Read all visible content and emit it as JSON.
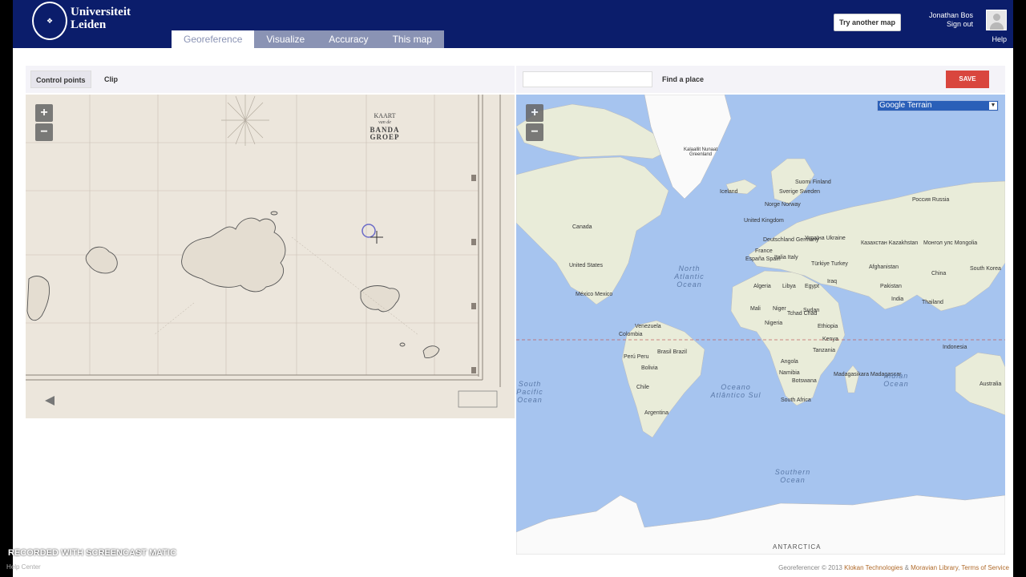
{
  "header": {
    "brand_line1": "Universiteit",
    "brand_line2": "Leiden",
    "tabs": [
      {
        "label": "Georeference",
        "active": true
      },
      {
        "label": "Visualize",
        "active": false
      },
      {
        "label": "Accuracy",
        "active": false
      },
      {
        "label": "This map",
        "active": false
      }
    ],
    "try_another_map": "Try another map",
    "user_name": "Jonathan Bos",
    "sign_out": "Sign out",
    "help": "Help"
  },
  "left_toolbar": {
    "control_points": "Control points",
    "clip": "Clip"
  },
  "old_map": {
    "title_line1": "KAART",
    "title_line2": "van de",
    "title_line3": "BANDA GROEP"
  },
  "zoom": {
    "in": "+",
    "out": "−"
  },
  "right_toolbar": {
    "search_value": "",
    "find_place": "Find a place",
    "save": "SAVE"
  },
  "map_type": {
    "selected": "Google Terrain"
  },
  "countries": {
    "kalaallit": "Kalaallit Nunaat Greenland",
    "iceland": "Iceland",
    "sverige": "Sverige Sweden",
    "suomi": "Suomi Finland",
    "norge": "Norge Norway",
    "uk": "United Kingdom",
    "deutschland": "Deutschland Germany",
    "ukraine": "Україна Ukraine",
    "kazakhstan": "Казахстан Kazakhstan",
    "russia": "Россия Russia",
    "mongolia": "Монгол улс Mongolia",
    "france": "France",
    "italia": "Italia Italy",
    "espana": "España Spain",
    "turkiye": "Türkiye Turkey",
    "iraq": "Iraq",
    "afghanistan": "Afghanistan",
    "china": "China",
    "south_korea": "South Korea",
    "canada": "Canada",
    "united_states": "United States",
    "mexico": "México Mexico",
    "algeria": "Algeria",
    "libya": "Libya",
    "egypt": "Egypt",
    "pakistan": "Pakistan",
    "india": "India",
    "thailand": "Thailand",
    "mali": "Mali",
    "niger": "Niger",
    "chad": "Tchad Chad",
    "sudan": "Sudan",
    "nigeria": "Nigeria",
    "ethiopia": "Ethiopia",
    "venezuela": "Venezuela",
    "colombia": "Colombia",
    "peru": "Perú Peru",
    "brasil": "Brasil Brazil",
    "bolivia": "Bolivia",
    "kenya": "Kenya",
    "tanzania": "Tanzania",
    "indonesia": "Indonesia",
    "angola": "Angola",
    "namibia": "Namibia",
    "botswana": "Botswana",
    "madagasikara": "Madagasikara Madagascar",
    "chile": "Chile",
    "argentina": "Argentina",
    "south_africa": "South Africa",
    "australia": "Australia"
  },
  "oceans": {
    "north_atlantic": "North Atlantic Ocean",
    "south_atlantic": "Oceano Atlântico Sul",
    "south_pacific": "South Pacific Ocean",
    "indian": "Indian Ocean",
    "southern": "Southern Ocean",
    "antarctica": "ANTARCTICA"
  },
  "footer": {
    "prefix": "Georeferencer © 2013 ",
    "klokan": "Klokan Technologies",
    "amp": " & ",
    "moravian": "Moravian Library",
    "sep": ", ",
    "terms": "Terms of Service"
  },
  "watermark": "RECORDED WITH SCREENCAST MATIC",
  "help_center": "Help Center",
  "colors": {
    "header": "#0b1d6b",
    "tab_inactive": "#8a93b4",
    "save": "#d9463e",
    "ocean": "#a6c4ef",
    "land": "#e9ecd9"
  }
}
